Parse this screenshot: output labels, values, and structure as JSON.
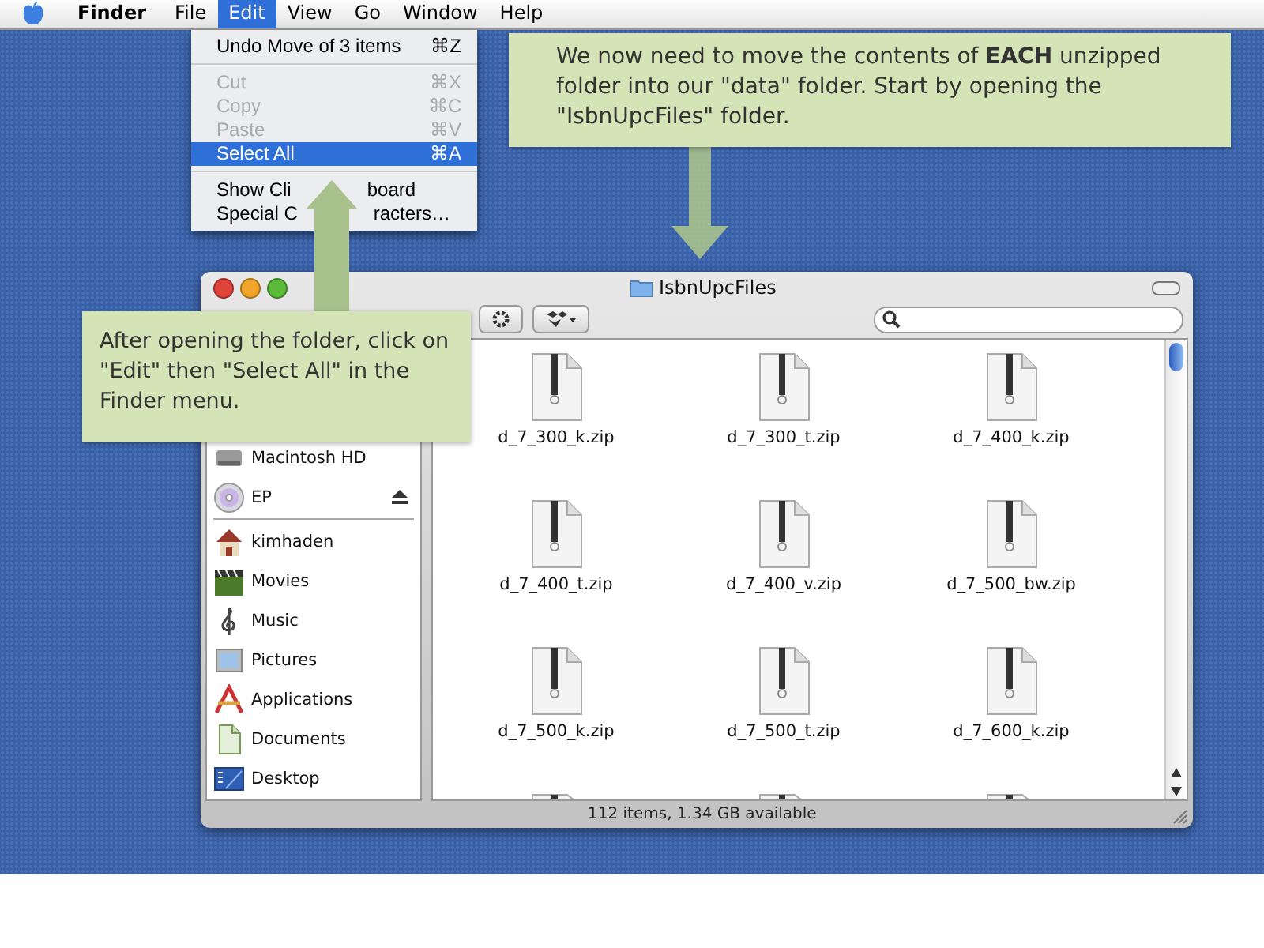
{
  "menu_bar": {
    "menus": [
      {
        "label": "Finder",
        "kind": "app",
        "selected": false
      },
      {
        "label": "File",
        "kind": "menu",
        "selected": false
      },
      {
        "label": "Edit",
        "kind": "menu",
        "selected": true
      },
      {
        "label": "View",
        "kind": "menu",
        "selected": false
      },
      {
        "label": "Go",
        "kind": "menu",
        "selected": false
      },
      {
        "label": "Window",
        "kind": "menu",
        "selected": false
      },
      {
        "label": "Help",
        "kind": "menu",
        "selected": false
      }
    ]
  },
  "edit_menu": {
    "items": [
      {
        "kind": "item",
        "parts": [
          "Undo Move of 3 items"
        ],
        "shortcut": "⌘Z",
        "disabled": false,
        "selected": false
      },
      {
        "kind": "separator"
      },
      {
        "kind": "item",
        "parts": [
          "Cut"
        ],
        "shortcut": "⌘X",
        "disabled": true,
        "selected": false
      },
      {
        "kind": "item",
        "parts": [
          "Copy"
        ],
        "shortcut": "⌘C",
        "disabled": true,
        "selected": false
      },
      {
        "kind": "item",
        "parts": [
          "Paste"
        ],
        "shortcut": "⌘V",
        "disabled": true,
        "selected": false
      },
      {
        "kind": "item",
        "parts": [
          "Select All"
        ],
        "shortcut": "⌘A",
        "disabled": false,
        "selected": true
      },
      {
        "kind": "separator"
      },
      {
        "kind": "item",
        "parts": [
          "Show Cli",
          "board"
        ],
        "disabled": false,
        "selected": false
      },
      {
        "kind": "item",
        "parts": [
          "Special C",
          "racters…"
        ],
        "disabled": false,
        "selected": false
      }
    ]
  },
  "finder_window": {
    "title": "IsbnUpcFiles",
    "sidebar": {
      "devices": [
        {
          "label": "Macintosh HD",
          "ejectable": false
        },
        {
          "label": "EP",
          "ejectable": true
        }
      ],
      "places": [
        {
          "label": "kimhaden"
        },
        {
          "label": "Movies"
        },
        {
          "label": "Music"
        },
        {
          "label": "Pictures"
        },
        {
          "label": "Applications"
        },
        {
          "label": "Documents"
        },
        {
          "label": "Desktop"
        }
      ]
    },
    "files": [
      "d_7_300_k.zip",
      "d_7_300_t.zip",
      "d_7_400_k.zip",
      "d_7_400_t.zip",
      "d_7_400_v.zip",
      "d_7_500_bw.zip",
      "d_7_500_k.zip",
      "d_7_500_t.zip",
      "d_7_600_k.zip"
    ],
    "status": "112 items, 1.34 GB available"
  },
  "callouts": [
    {
      "text": "We now need to move the contents of **EACH** unzipped folder into our \"data\" folder. Start by opening the \"IsbnUpcFiles\" folder."
    },
    {
      "text": "After opening the folder, click on \"Edit\" then \"Select All\" in the Finder menu."
    }
  ]
}
